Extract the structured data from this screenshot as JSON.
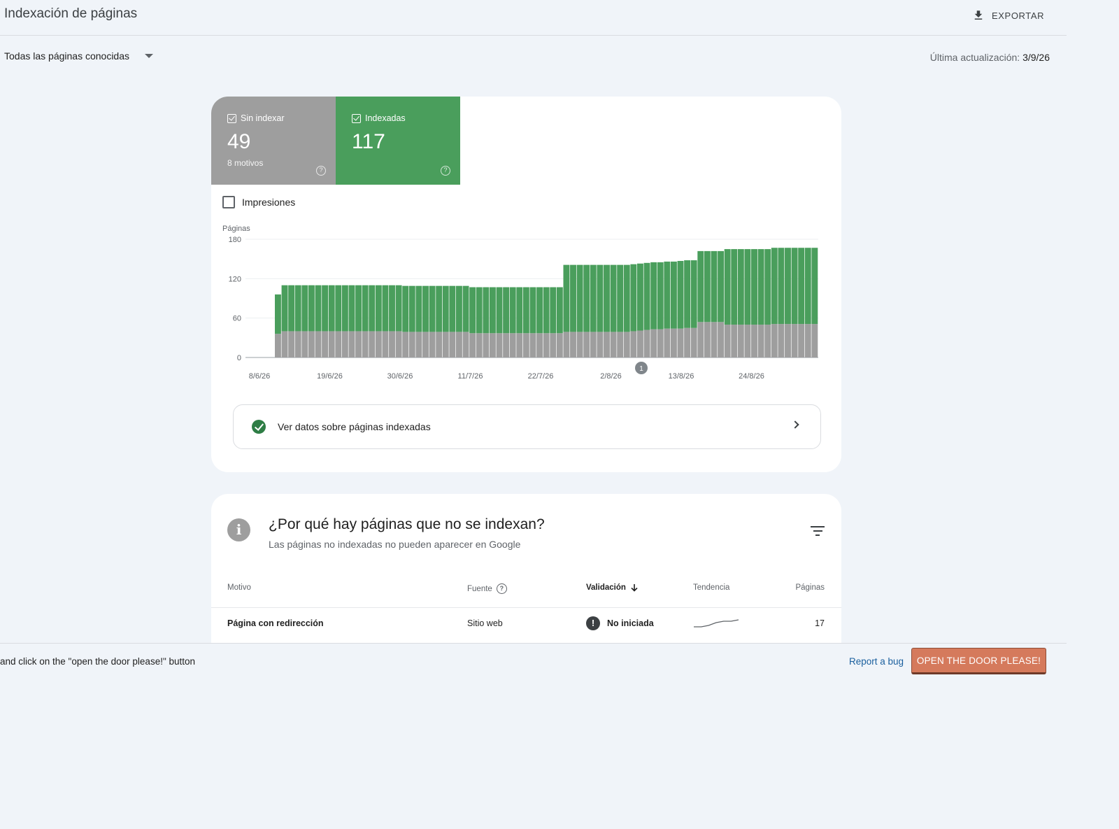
{
  "header": {
    "title": "Indexación de páginas",
    "export_label": "EXPORTAR"
  },
  "toolbar": {
    "filter_value": "Todas las páginas conocidas",
    "last_update_label": "Última actualización:",
    "last_update_value": "3/9/26"
  },
  "tiles": {
    "not_indexed": {
      "label": "Sin indexar",
      "value": "49",
      "sub": "8 motivos",
      "color": "#9e9e9e"
    },
    "indexed": {
      "label": "Indexadas",
      "value": "117",
      "color": "#4a9e5c"
    }
  },
  "impressions_label": "Impresiones",
  "chart_data": {
    "type": "bar",
    "stacked": true,
    "ylabel": "Páginas",
    "ylim": [
      0,
      180
    ],
    "yticks": [
      0,
      60,
      120,
      180
    ],
    "xtick_labels": [
      "8/6/26",
      "19/6/26",
      "30/6/26",
      "11/7/26",
      "22/7/26",
      "2/8/26",
      "13/8/26",
      "24/8/26"
    ],
    "annotation": "1",
    "grid": true,
    "series": [
      {
        "color": "#9e9e9e",
        "values": [
          36,
          40,
          40,
          40,
          40,
          40,
          40,
          40,
          40,
          40,
          40,
          40,
          40,
          40,
          40,
          40,
          40,
          40,
          40,
          39,
          39,
          39,
          39,
          39,
          39,
          39,
          39,
          39,
          39,
          37,
          37,
          37,
          37,
          37,
          37,
          37,
          37,
          37,
          37,
          37,
          37,
          37,
          37,
          39,
          39,
          39,
          39,
          39,
          39,
          39,
          39,
          39,
          39,
          40,
          41,
          42,
          43,
          43,
          44,
          44,
          44,
          45,
          45,
          54,
          54,
          54,
          54,
          50,
          50,
          50,
          50,
          50,
          50,
          50,
          51,
          51,
          51,
          51,
          51,
          51,
          51
        ]
      },
      {
        "color": "#4a9e5c",
        "values": [
          60,
          70,
          70,
          70,
          70,
          70,
          70,
          70,
          70,
          70,
          70,
          70,
          70,
          70,
          70,
          70,
          70,
          70,
          70,
          70,
          70,
          70,
          70,
          70,
          70,
          70,
          70,
          70,
          70,
          70,
          70,
          70,
          70,
          70,
          70,
          70,
          70,
          70,
          70,
          70,
          70,
          70,
          70,
          102,
          102,
          102,
          102,
          102,
          102,
          102,
          102,
          102,
          102,
          102,
          102,
          102,
          102,
          102,
          102,
          102,
          103,
          103,
          103,
          108,
          108,
          108,
          108,
          115,
          115,
          115,
          115,
          115,
          115,
          115,
          116,
          116,
          116,
          116,
          116,
          116,
          116
        ]
      }
    ]
  },
  "link_row_label": "Ver datos sobre páginas indexadas",
  "reasons": {
    "title": "¿Por qué hay páginas que no se indexan?",
    "subtitle": "Las páginas no indexadas no pueden aparecer en Google",
    "columns": {
      "reason": "Motivo",
      "source": "Fuente",
      "validation": "Validación",
      "trend": "Tendencia",
      "pages": "Páginas"
    },
    "rows": [
      {
        "reason": "Página con redirección",
        "source": "Sitio web",
        "validation": "No iniciada",
        "pages": "17",
        "trend": [
          12,
          12,
          13,
          15,
          16,
          16,
          17
        ]
      }
    ]
  },
  "bottom_bar": {
    "instruction": "and click on the \"open the door please!\" button",
    "report_label": "Report a bug",
    "door_button_label": "OPEN THE DOOR PLEASE!",
    "door_button_color": "#d57a5c"
  }
}
